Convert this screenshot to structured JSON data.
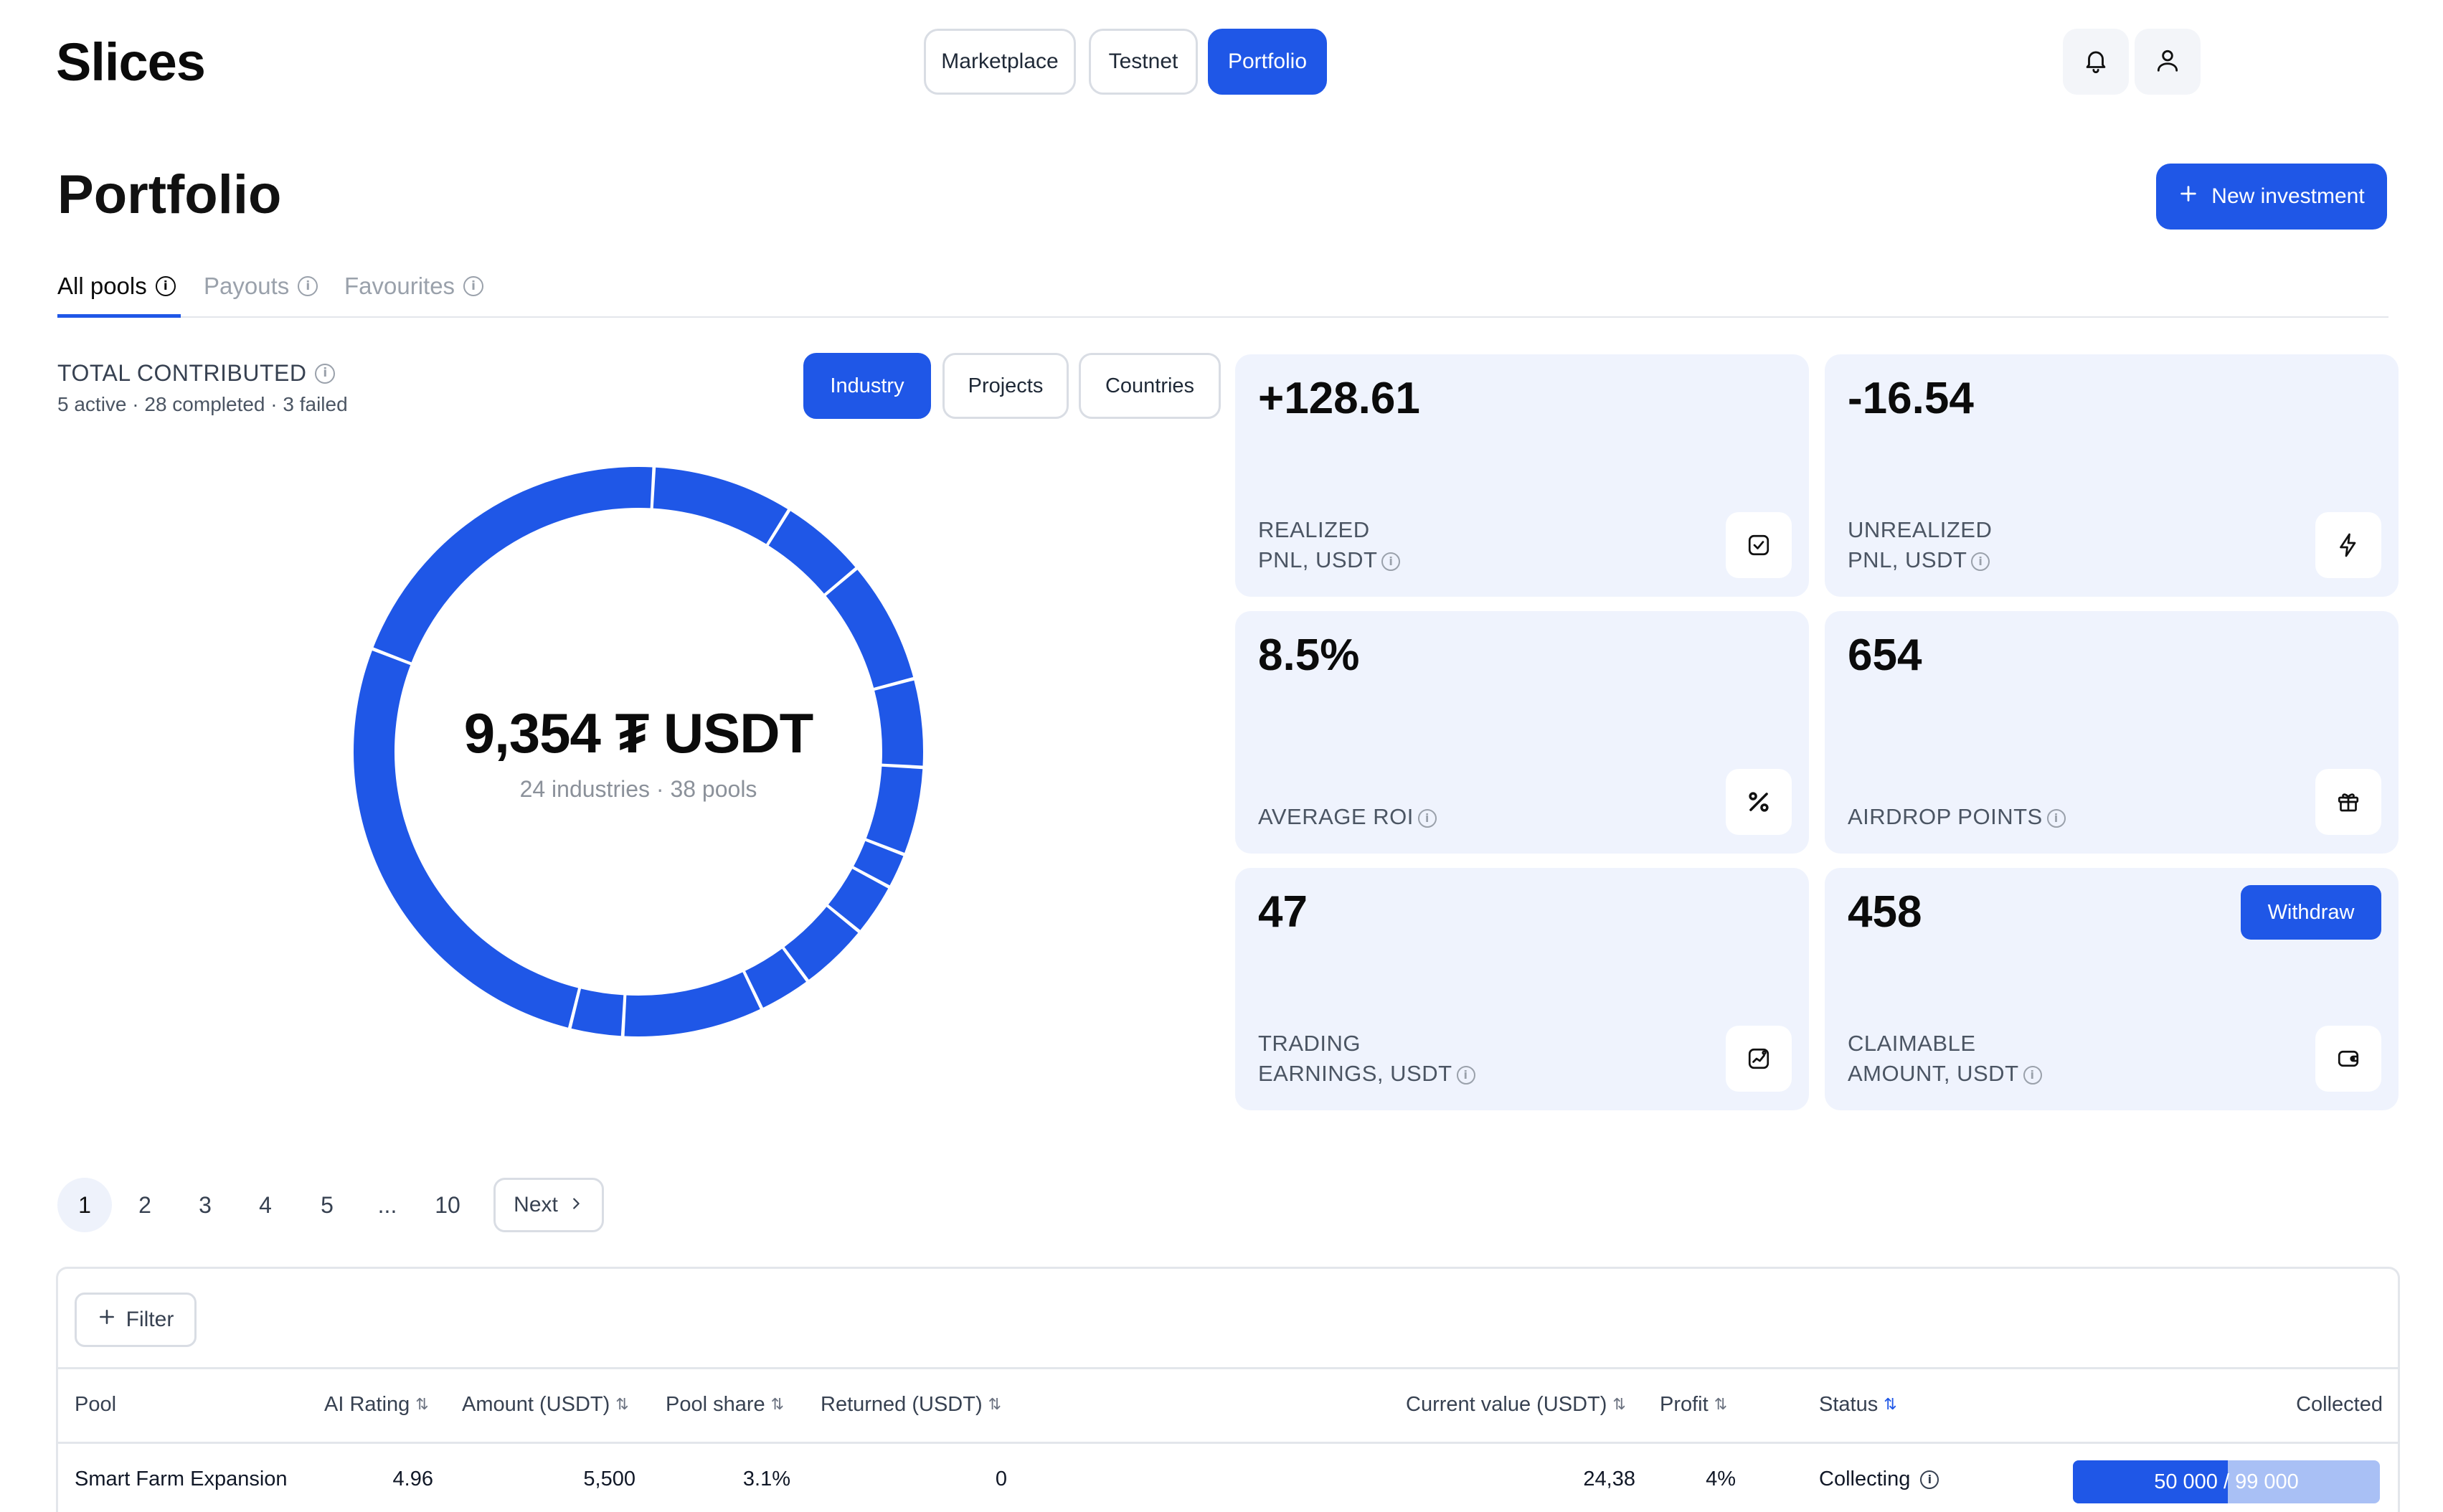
{
  "header": {
    "logo": "Slices",
    "nav": [
      "Marketplace",
      "Testnet",
      "Portfolio"
    ],
    "active_nav": "Portfolio",
    "icons": [
      "bell-icon",
      "user-icon"
    ]
  },
  "page": {
    "title": "Portfolio",
    "new_investment_label": "New investment",
    "tabs": [
      "All pools",
      "Payouts",
      "Favourites"
    ],
    "active_tab": "All pools"
  },
  "summary": {
    "label": "TOTAL CONTRIBUTED",
    "sub": "5 active · 28 completed · 3 failed",
    "segments": [
      "Industry",
      "Projects",
      "Countries"
    ],
    "active_segment": "Industry",
    "total_value": "9,354 ₮ USDT",
    "total_sub": "24 industries · 38 pools"
  },
  "donut": {
    "color": "#1f57e7",
    "slices": [
      8,
      5,
      7,
      5,
      5,
      2,
      3,
      4,
      3,
      8,
      3,
      27,
      20
    ]
  },
  "cards": [
    {
      "value": "+128.61",
      "label_line1": "REALIZED",
      "label_line2": "PNL, USDT",
      "icon": "check-square-icon"
    },
    {
      "value": "-16.54",
      "label_line1": "UNREALIZED",
      "label_line2": "PNL, USDT",
      "icon": "lightning-icon"
    },
    {
      "value": "8.5%",
      "label_line1": "",
      "label_line2": "AVERAGE ROI",
      "icon": "percent-icon"
    },
    {
      "value": "654",
      "label_line1": "",
      "label_line2": "AIRDROP POINTS",
      "icon": "gift-icon"
    },
    {
      "value": "47",
      "label_line1": "TRADING",
      "label_line2": "EARNINGS, USDT",
      "icon": "trend-chart-icon"
    },
    {
      "value": "458",
      "label_line1": "CLAIMABLE",
      "label_line2": "AMOUNT, USDT",
      "icon": "wallet-icon",
      "withdraw_label": "Withdraw"
    }
  ],
  "pagination": {
    "pages": [
      "1",
      "2",
      "3",
      "4",
      "5",
      "...",
      "10"
    ],
    "current": "1",
    "next_label": "Next"
  },
  "table": {
    "filter_label": "Filter",
    "headers": {
      "pool": "Pool",
      "ai_rating": "AI Rating",
      "amount": "Amount (USDT)",
      "pool_share": "Pool share",
      "returned": "Returned (USDT)",
      "current_value": "Current value (USDT)",
      "profit": "Profit",
      "status": "Status",
      "collected": "Collected"
    },
    "rows": [
      {
        "pool": "Smart Farm Expansion",
        "ai_rating": "4.96",
        "amount": "5,500",
        "pool_share": "3.1%",
        "returned": "0",
        "current_value": "24,38",
        "profit": "4%",
        "status": "Collecting",
        "collected": "50 000 / 99 000",
        "collected_fraction": 0.505
      }
    ]
  }
}
